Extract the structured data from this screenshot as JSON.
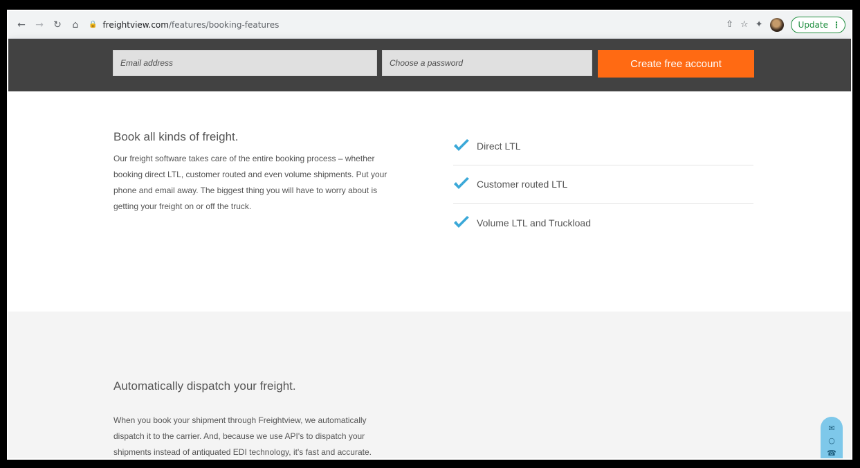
{
  "browser": {
    "url_host": "freightview.com",
    "url_path": "/features/booking-features",
    "update_label": "Update"
  },
  "signup": {
    "email_placeholder": "Email address",
    "password_placeholder": "Choose a password",
    "cta_label": "Create free account"
  },
  "section_booking": {
    "title": "Book all kinds of freight.",
    "paragraph_lines": [
      "Our freight software takes care of the entire booking process – whether",
      "booking direct LTL, customer routed and even volume shipments. Put your",
      "phone and email away. The biggest thing you will have to worry about is",
      "getting your freight on or off the truck."
    ],
    "features": [
      "Direct LTL",
      "Customer routed LTL",
      "Volume LTL and Truckload"
    ]
  },
  "section_dispatch": {
    "title": "Automatically dispatch your freight.",
    "paragraph_lines": [
      "When you book your shipment through Freightview, we automatically",
      "dispatch it to the carrier. And, because we use API's to dispatch your",
      "shipments instead of antiquated EDI technology, it's fast and accurate."
    ]
  },
  "colors": {
    "accent": "#ff6a13",
    "check": "#3aa8d8",
    "band": "#424242"
  }
}
